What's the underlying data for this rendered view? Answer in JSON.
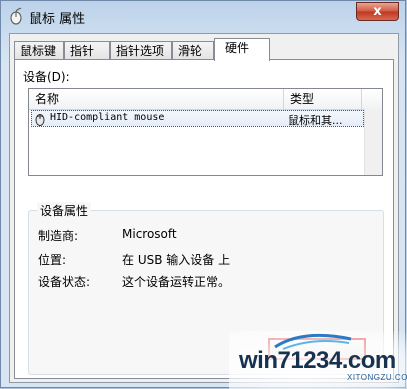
{
  "window": {
    "title": "鼠标 属性",
    "close_glyph": "x",
    "icon": "mouse-properties-icon"
  },
  "tabs": [
    {
      "label": "鼠标键",
      "active": false
    },
    {
      "label": "指针",
      "active": false
    },
    {
      "label": "指针选项",
      "active": false
    },
    {
      "label": "滑轮",
      "active": false
    },
    {
      "label": "硬件",
      "active": true
    }
  ],
  "devices": {
    "label": "设备(D):",
    "columns": {
      "name": "名称",
      "type": "类型"
    },
    "rows": [
      {
        "name": "HID-compliant mouse",
        "type": "鼠标和其...",
        "icon": "mouse-icon",
        "selected": true
      }
    ]
  },
  "properties": {
    "group_title": "设备属性",
    "manufacturer_label": "制造商:",
    "manufacturer_value": "Microsoft",
    "location_label": "位置:",
    "location_value": "在 USB 输入设备 上",
    "status_label": "设备状态:",
    "status_value": "这个设备运转正常。"
  },
  "watermark": {
    "text": "win71234.com",
    "subtext": "XITONGZU.COM"
  },
  "colors": {
    "highlight_border": "#dd2222",
    "title_bar": "#bcd2ea",
    "close_button": "#c0361f"
  }
}
